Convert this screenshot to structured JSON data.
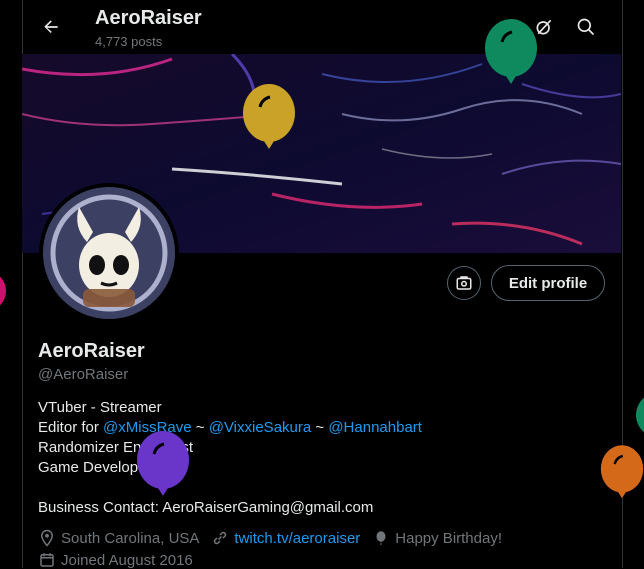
{
  "header": {
    "name": "AeroRaiser",
    "posts": "4,773 posts"
  },
  "icons": {
    "back": "arrow-left-icon",
    "grok": "grok-icon",
    "search": "search-icon",
    "media": "media-icon",
    "location": "location-pin-icon",
    "link": "link-icon",
    "birthday": "balloon-icon",
    "calendar": "calendar-icon"
  },
  "profile": {
    "edit_label": "Edit profile",
    "display_name": "AeroRaiser",
    "handle": "@AeroRaiser",
    "bio": {
      "line1": "VTuber - Streamer",
      "line2_prefix": "Editor for ",
      "mention1": "@xMissRave",
      "sep1": " ~ ",
      "mention2": "@VixxieSakura",
      "sep2": " ~ ",
      "mention3": "@Hannahbart",
      "line3": "Randomizer Enthusiast",
      "line4": "Game Developer",
      "line6": "Business Contact: AeroRaiserGaming@gmail.com"
    },
    "location": "South Carolina, USA",
    "website": "twitch.tv/aeroraiser",
    "birthday": "Happy Birthday!",
    "joined": "Joined August 2016"
  },
  "colors": {
    "accent": "#1d9bf0",
    "balloon_green": "#0f8a5f",
    "balloon_yellow": "#c9a227",
    "balloon_purple": "#6a35c9",
    "balloon_orange": "#d4691a",
    "balloon_pink": "#d0106f"
  }
}
